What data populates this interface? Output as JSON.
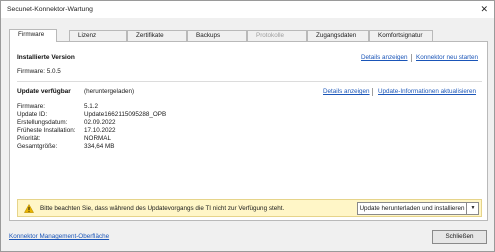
{
  "window": {
    "title": "Secunet-Konnektor-Wartung",
    "close_glyph": "✕"
  },
  "tabs": [
    {
      "label": "Firmware",
      "state": "active"
    },
    {
      "label": "Lizenz",
      "state": "normal"
    },
    {
      "label": "Zertifikate",
      "state": "normal"
    },
    {
      "label": "Backups",
      "state": "normal"
    },
    {
      "label": "Protokolle",
      "state": "disabled"
    },
    {
      "label": "Zugangsdaten",
      "state": "normal"
    },
    {
      "label": "Komfortsignatur",
      "state": "normal"
    }
  ],
  "installed": {
    "heading": "Installierte Version",
    "details_link": "Details anzeigen",
    "restart_link": "Konnektor neu starten",
    "firmware_label": "Firmware: 5.0.5"
  },
  "update": {
    "heading": "Update verfügbar",
    "status": "(heruntergeladen)",
    "details_link": "Details anzeigen",
    "refresh_link": "Update-Informationen aktualisieren",
    "fields": [
      {
        "label": "Firmware:",
        "value": "5.1.2"
      },
      {
        "label": "Update ID:",
        "value": "Update1662115095288_OPB"
      },
      {
        "label": "Erstellungsdatum:",
        "value": "02.09.2022"
      },
      {
        "label": "Früheste Installation:",
        "value": "17.10.2022"
      },
      {
        "label": "Priorität:",
        "value": "NORMAL"
      },
      {
        "label": "Gesamtgröße:",
        "value": "334,64 MB"
      }
    ]
  },
  "notice": {
    "icon": "warning-icon",
    "text": "Bitte beachten Sie, dass während des Updatevorgangs die TI nicht zur Verfügung steht.",
    "button_label": "Update herunterladen und installieren",
    "dropdown_glyph": "▼"
  },
  "footer": {
    "management_link": "Konnektor Management-Oberfläche",
    "close_label": "Schließen"
  },
  "colors": {
    "link": "#1a55b8",
    "notice_bg": "#fff6c7",
    "warning": "#e8b400"
  }
}
